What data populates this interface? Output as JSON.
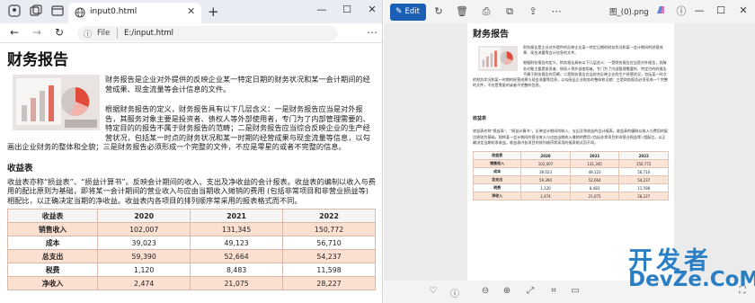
{
  "browser": {
    "tab_title": "input0.html",
    "url_scheme_label": "File",
    "url": "E:/input.html",
    "new_tab": "+",
    "tab_close": "✕"
  },
  "report": {
    "title": "财务报告",
    "para1": "财务报告是企业对外提供的反映企业某一特定日期的财务状况和某一会计期间的经营成果、现金流量等会计信息的文件。",
    "para2": "根据财务报告的定义，财务报告具有以下几层含义：一是财务报告应当是对外报告，其服务对象主要是投资者、债权人等外部使用者，专门为了内部管理需要的、特定目的的报告不属于财务报告的范畴；二是财务报告应当综合反映企业的生产经营状况，包括某一时点的财务状况和某一时期的经营成果与现金流量等信息，以勾画出企业财务的整体和全貌；三是财务报告必须形成一个完整的文件，不应是零星的或者不完整的信息。",
    "section_title": "收益表",
    "para3": "收益表亦称“损益表”、“损益计算书”。反映会计期间的收入、支出及净收益的会计报表。收益表的编制以收入与费用的配比原则为基础，即将某一会计期间的营业收入与应由当期收入摊销的费用 (包括非常项目和非营业损益等) 相配比，以正确决定当期的净收益。收益表内各项目的排列顺序常采用的报表格式而不同。",
    "table": {
      "headers": [
        "收益表",
        "2020",
        "2021",
        "2022"
      ],
      "rows": [
        [
          "销售收入",
          "102,007",
          "131,345",
          "150,772"
        ],
        [
          "成本",
          "39,023",
          "49,123",
          "56,710"
        ],
        [
          "总支出",
          "59,390",
          "52,664",
          "54,237"
        ],
        [
          "税费",
          "1,120",
          "8,483",
          "11,598"
        ],
        [
          "净收入",
          "2,474",
          "21,075",
          "28,227"
        ]
      ]
    }
  },
  "photos": {
    "edit_label": "Edit",
    "file_name": "图_(0).png",
    "doc": {
      "para1": "财务报告是企业对外提供的反映企业某一特定日期的财务状况和某一会计期间的经营成果、现金流量等会计信息的文件。",
      "para2": "根据财务报告的定义，财务报告具有以下几层含义：一是财务报告应当是对外报告，其服务对象主要是投资者、债权人等外部使用者，专门为了内部管理需要的、特定目的的报告不属于财务报告的范畴；二是财务报告应当综合反映企业的生产经营状况，包括某一时点的财务状况和某一时期的经营成果与现金流量等信息，以勾画出企业财务的整体和全貌；三是财务报告必须形成一个完整的文件，不应是零星的或者不完整的信息。",
      "para3": "收益表亦称“损益表”、“损益计算书”。反映会计期间的收入、支出及净收益的会计报表。收益表的编制以收入与费用的配比原则为基础，即将某一会计期间的营业收入与应由当期收入摊销的费用 (包括非常项目和非营业损益等) 相配比，以正确决定当期的净收益。收益表内各项目的排列顺序常采用的报表格式而不同。"
    }
  },
  "watermark": {
    "cn": "开发者",
    "en": "DevZe.CoM"
  },
  "colors": {
    "odd_row": "#fbe0d2",
    "edit_button": "#1a5fb4",
    "watermark": "#2a7fc4"
  }
}
